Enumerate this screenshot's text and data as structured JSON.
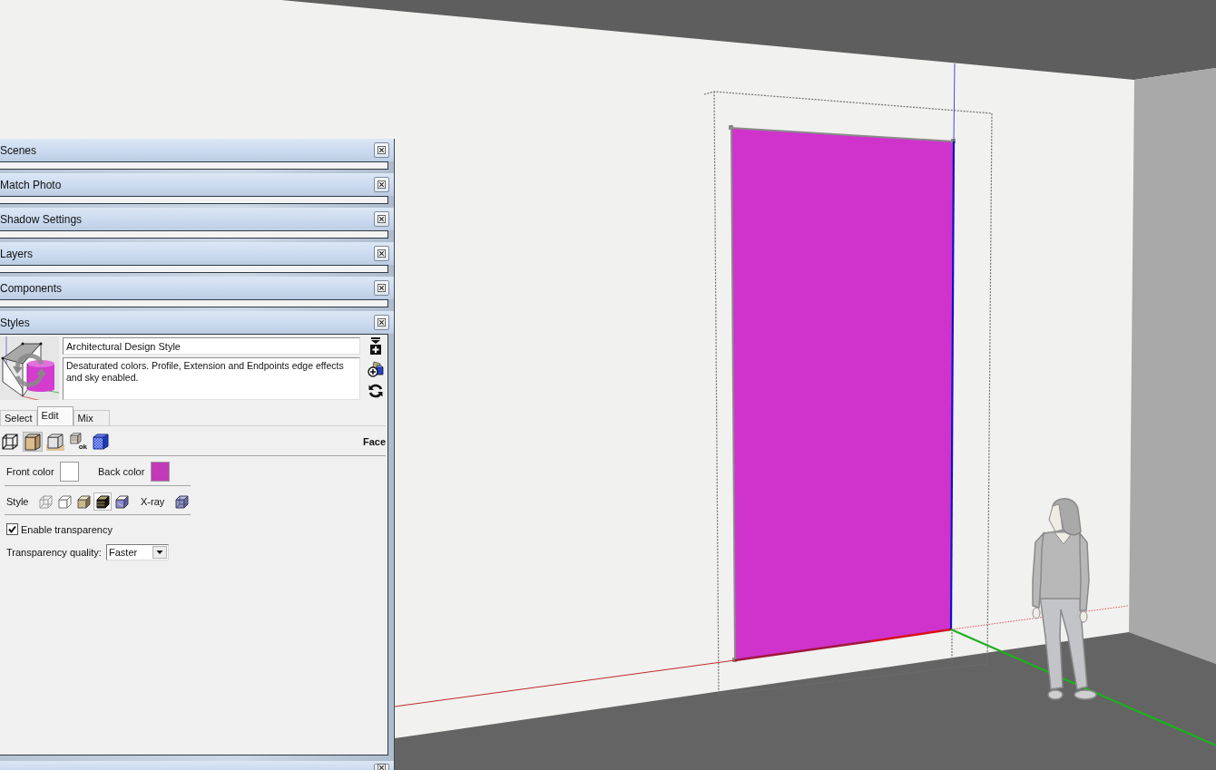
{
  "tray": {
    "panels": [
      {
        "title": "Scenes",
        "expanded": false
      },
      {
        "title": "Match Photo",
        "expanded": false
      },
      {
        "title": "Shadow Settings",
        "expanded": false
      },
      {
        "title": "Layers",
        "expanded": false
      },
      {
        "title": "Components",
        "expanded": false
      },
      {
        "title": "Styles",
        "expanded": true,
        "body": {
          "style_name": "Architectural Design Style",
          "description": "Desaturated colors. Profile, Extension and Endpoints edge effects and sky enabled.",
          "tabs": [
            {
              "label": "Select",
              "selected": false
            },
            {
              "label": "Edit",
              "selected": true
            },
            {
              "label": "Mix",
              "selected": false
            }
          ],
          "edit_tools": [
            {
              "kind": "edge",
              "selected": false
            },
            {
              "kind": "face",
              "selected": true
            },
            {
              "kind": "background",
              "selected": false
            },
            {
              "kind": "watermark",
              "selected": false,
              "badge": "ok"
            },
            {
              "kind": "modeling",
              "selected": false
            }
          ],
          "section_title": "Face",
          "colors": [
            {
              "label": "Front color",
              "color": "#ffffff"
            },
            {
              "label": "Back color",
              "color": "#c23ab8"
            }
          ],
          "style_label": "Style",
          "face_styles": [
            {
              "kind": "wireframe",
              "selected": false
            },
            {
              "kind": "hidden-line",
              "selected": false
            },
            {
              "kind": "shaded",
              "selected": false
            },
            {
              "kind": "textured",
              "selected": true
            },
            {
              "kind": "monochrome",
              "selected": false
            }
          ],
          "xray": {
            "label": "X-ray",
            "on": false
          },
          "transparency": {
            "label": "Enable transparency",
            "checked": true
          },
          "quality": {
            "label": "Transparency quality:",
            "value": "Faster"
          }
        }
      }
    ]
  }
}
